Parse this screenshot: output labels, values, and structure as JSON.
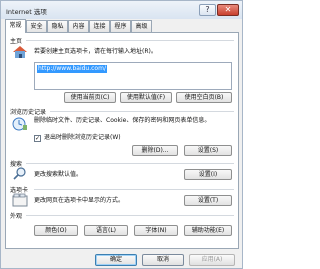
{
  "window": {
    "title": "Internet 选项"
  },
  "tabs": [
    {
      "label": "常规"
    },
    {
      "label": "安全"
    },
    {
      "label": "隐私"
    },
    {
      "label": "内容"
    },
    {
      "label": "连接"
    },
    {
      "label": "程序"
    },
    {
      "label": "高级"
    }
  ],
  "home": {
    "title": "主页",
    "description": "若要创建主页选项卡，请在每行输入地址(R)。",
    "url": "http://www.baidu.com/",
    "buttons": {
      "current": "使用当前页(C)",
      "default": "使用默认值(F)",
      "blank": "使用空白页(B)"
    }
  },
  "history": {
    "title": "浏览历史记录",
    "description": "删除临时文件、历史记录、Cookie、保存的密码和网页表单信息。",
    "exit_delete_label": "退出时删除浏览历史记录(W)",
    "exit_delete_checked": true,
    "buttons": {
      "delete": "删除(D)...",
      "settings": "设置(S)"
    }
  },
  "search": {
    "title": "搜索",
    "description": "更改搜索默认值。",
    "settings_button": "设置(I)"
  },
  "tabs_section": {
    "title": "选项卡",
    "description": "更改网页在选项卡中显示的方式。",
    "settings_button": "设置(T)"
  },
  "appearance": {
    "title": "外观",
    "buttons": {
      "colors": "颜色(O)",
      "languages": "语言(L)",
      "fonts": "字体(N)",
      "accessibility": "辅助功能(E)"
    }
  },
  "dialog_buttons": {
    "ok": "确定",
    "cancel": "取消",
    "apply": "应用(A)"
  }
}
